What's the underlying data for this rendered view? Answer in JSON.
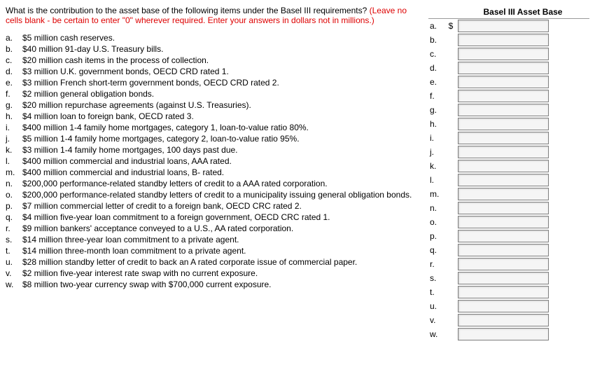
{
  "question": {
    "main": "What is the contribution to the asset base of the following items under the Basel III requirements? ",
    "note": "(Leave no cells blank - be certain to enter \"0\" wherever required. Enter your answers in dollars not in millions.)"
  },
  "items": [
    {
      "letter": "a.",
      "text": "$5 million cash reserves."
    },
    {
      "letter": "b.",
      "text": "$40 million 91-day U.S. Treasury bills."
    },
    {
      "letter": "c.",
      "text": "$20 million cash items in the process of collection."
    },
    {
      "letter": "d.",
      "text": "$3 million U.K. government bonds, OECD CRD rated 1."
    },
    {
      "letter": "e.",
      "text": "$3 million French short-term government bonds, OECD CRD rated 2."
    },
    {
      "letter": "f.",
      "text": "$2 million general obligation bonds."
    },
    {
      "letter": "g.",
      "text": "$20 million repurchase agreements (against U.S. Treasuries)."
    },
    {
      "letter": "h.",
      "text": "$4 million loan to foreign bank, OECD rated 3."
    },
    {
      "letter": "i.",
      "text": "$400 million 1-4 family home mortgages, category 1, loan-to-value ratio 80%."
    },
    {
      "letter": "j.",
      "text": "$5 million 1-4 family home mortgages, category 2, loan-to-value ratio 95%."
    },
    {
      "letter": "k.",
      "text": "$3 million 1-4 family home mortgages, 100 days past due."
    },
    {
      "letter": "l.",
      "text": "$400 million commercial and industrial loans, AAA rated."
    },
    {
      "letter": "m.",
      "text": "$400 million commercial and industrial loans, B- rated."
    },
    {
      "letter": "n.",
      "text": "$200,000 performance-related standby letters of credit to a AAA rated corporation."
    },
    {
      "letter": "o.",
      "text": "$200,000 performance-related standby letters of credit to a municipality issuing general obligation bonds."
    },
    {
      "letter": "p.",
      "text": "$7 million commercial letter of credit to a foreign bank, OECD CRC rated 2."
    },
    {
      "letter": "q.",
      "text": "$4 million five-year loan commitment to a foreign government, OECD CRC rated 1."
    },
    {
      "letter": "r.",
      "text": "$9 million bankers' acceptance conveyed to a U.S., AA rated corporation."
    },
    {
      "letter": "s.",
      "text": "$14 million three-year loan commitment to a private agent."
    },
    {
      "letter": "t.",
      "text": "$14 million three-month loan commitment to a private agent."
    },
    {
      "letter": "u.",
      "text": "$28 million standby letter of credit to back an A rated corporate issue of commercial paper."
    },
    {
      "letter": "v.",
      "text": "$2 million five-year interest rate swap with no current exposure."
    },
    {
      "letter": "w.",
      "text": "$8 million two-year currency swap with $700,000 current exposure."
    }
  ],
  "answer_header": "Basel III Asset Base",
  "dollar_sign": "$",
  "answers": [
    {
      "letter": "a.",
      "show_dollar": true,
      "value": ""
    },
    {
      "letter": "b.",
      "show_dollar": false,
      "value": ""
    },
    {
      "letter": "c.",
      "show_dollar": false,
      "value": ""
    },
    {
      "letter": "d.",
      "show_dollar": false,
      "value": ""
    },
    {
      "letter": "e.",
      "show_dollar": false,
      "value": ""
    },
    {
      "letter": "f.",
      "show_dollar": false,
      "value": ""
    },
    {
      "letter": "g.",
      "show_dollar": false,
      "value": ""
    },
    {
      "letter": "h.",
      "show_dollar": false,
      "value": ""
    },
    {
      "letter": "i.",
      "show_dollar": false,
      "value": ""
    },
    {
      "letter": "j.",
      "show_dollar": false,
      "value": ""
    },
    {
      "letter": "k.",
      "show_dollar": false,
      "value": ""
    },
    {
      "letter": "l.",
      "show_dollar": false,
      "value": ""
    },
    {
      "letter": "m.",
      "show_dollar": false,
      "value": ""
    },
    {
      "letter": "n.",
      "show_dollar": false,
      "value": ""
    },
    {
      "letter": "o.",
      "show_dollar": false,
      "value": ""
    },
    {
      "letter": "p.",
      "show_dollar": false,
      "value": ""
    },
    {
      "letter": "q.",
      "show_dollar": false,
      "value": ""
    },
    {
      "letter": "r.",
      "show_dollar": false,
      "value": ""
    },
    {
      "letter": "s.",
      "show_dollar": false,
      "value": ""
    },
    {
      "letter": "t.",
      "show_dollar": false,
      "value": ""
    },
    {
      "letter": "u.",
      "show_dollar": false,
      "value": ""
    },
    {
      "letter": "v.",
      "show_dollar": false,
      "value": ""
    },
    {
      "letter": "w.",
      "show_dollar": false,
      "value": ""
    }
  ]
}
